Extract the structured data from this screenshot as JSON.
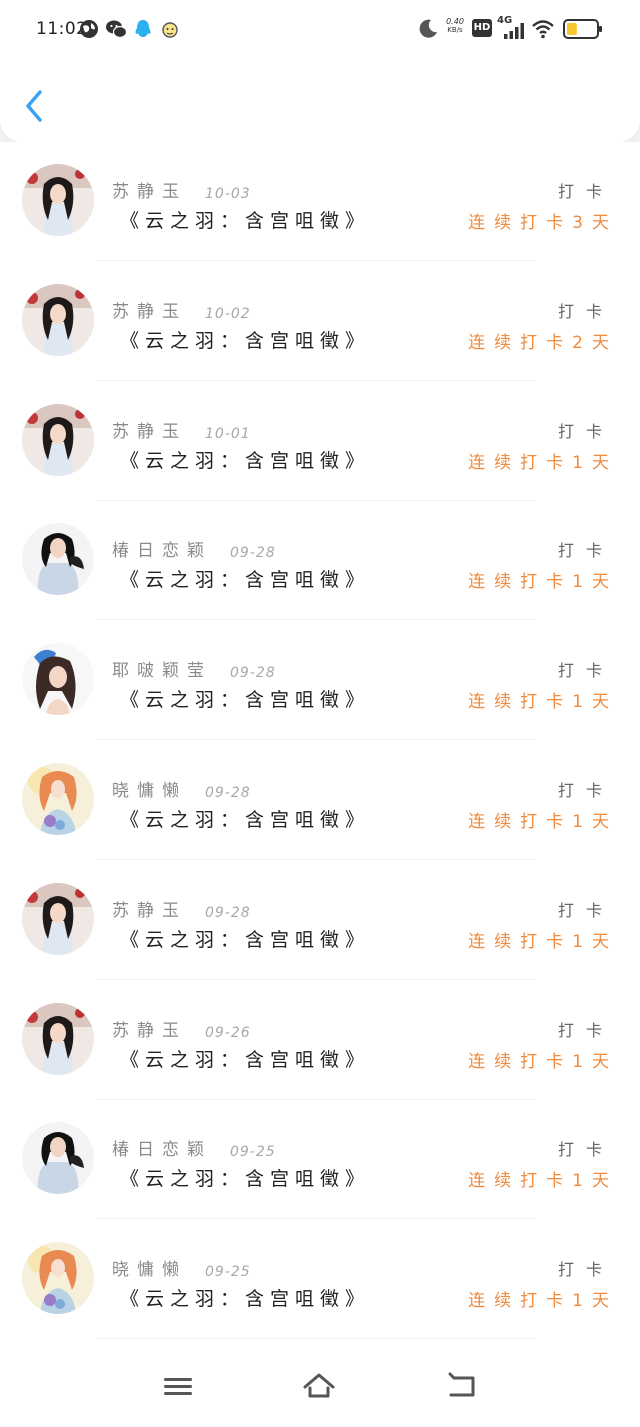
{
  "status_bar": {
    "time": "11:02",
    "net_speed_value": "0.40",
    "net_speed_unit": "KB/s",
    "hd_label": "HD",
    "network_label": "4G",
    "battery_level": 0.35,
    "icons": [
      "globe-icon",
      "wechat-icon",
      "qq-icon",
      "app-icon",
      "moon-icon",
      "signal-icon",
      "wifi-icon",
      "battery-icon"
    ]
  },
  "header": {
    "back_icon": "back-arrow-icon",
    "accent_color": "#3aa0f2"
  },
  "colors": {
    "streak": "#f08a3c",
    "name": "#8a8a8a",
    "title": "#222222"
  },
  "rows": [
    {
      "name": "苏静玉",
      "date": "10-03",
      "title": "《云之羽：含宫咀徵》",
      "punch": "打卡",
      "streak": "连续打卡3天",
      "avatar": "woman-dark-hair"
    },
    {
      "name": "苏静玉",
      "date": "10-02",
      "title": "《云之羽：含宫咀徵》",
      "punch": "打卡",
      "streak": "连续打卡2天",
      "avatar": "woman-dark-hair"
    },
    {
      "name": "苏静玉",
      "date": "10-01",
      "title": "《云之羽：含宫咀徵》",
      "punch": "打卡",
      "streak": "连续打卡1天",
      "avatar": "woman-dark-hair"
    },
    {
      "name": "椿日恋颖",
      "date": "09-28",
      "title": "《云之羽：含宫咀徵》",
      "punch": "打卡",
      "streak": "连续打卡1天",
      "avatar": "woman-white-dress"
    },
    {
      "name": "耶啵颖莹",
      "date": "09-28",
      "title": "《云之羽：含宫咀徵》",
      "punch": "打卡",
      "streak": "连续打卡1天",
      "avatar": "woman-blue-flower"
    },
    {
      "name": "晓慵懒",
      "date": "09-28",
      "title": "《云之羽：含宫咀徵》",
      "punch": "打卡",
      "streak": "连续打卡1天",
      "avatar": "illustration-girl"
    },
    {
      "name": "苏静玉",
      "date": "09-28",
      "title": "《云之羽：含宫咀徵》",
      "punch": "打卡",
      "streak": "连续打卡1天",
      "avatar": "woman-dark-hair"
    },
    {
      "name": "苏静玉",
      "date": "09-26",
      "title": "《云之羽：含宫咀徵》",
      "punch": "打卡",
      "streak": "连续打卡1天",
      "avatar": "woman-dark-hair"
    },
    {
      "name": "椿日恋颖",
      "date": "09-25",
      "title": "《云之羽：含宫咀徵》",
      "punch": "打卡",
      "streak": "连续打卡1天",
      "avatar": "woman-white-dress"
    },
    {
      "name": "晓慵懒",
      "date": "09-25",
      "title": "《云之羽：含宫咀徵》",
      "punch": "打卡",
      "streak": "连续打卡1天",
      "avatar": "illustration-girl"
    }
  ],
  "nav_bar": {
    "icons": [
      "menu-icon",
      "home-icon",
      "back-icon"
    ]
  }
}
